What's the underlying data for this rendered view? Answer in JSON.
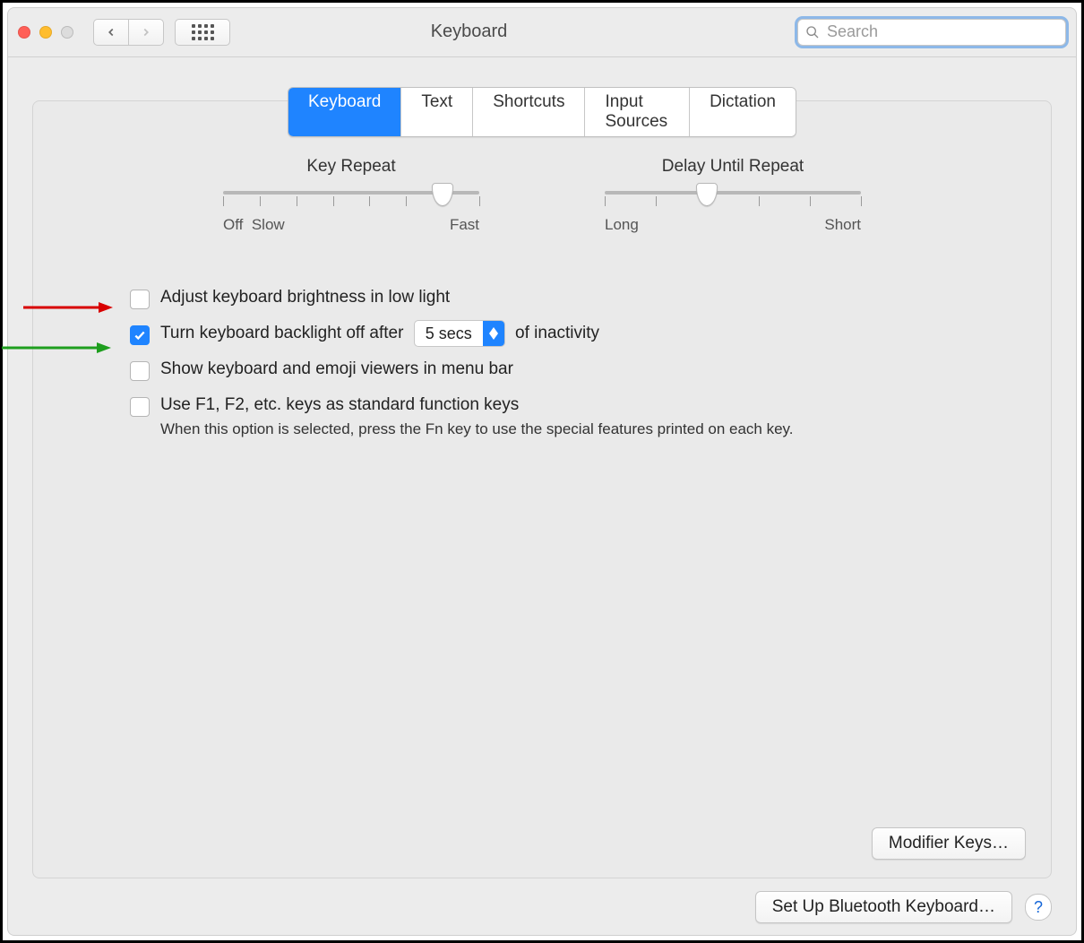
{
  "title": "Keyboard",
  "search": {
    "placeholder": "Search",
    "value": ""
  },
  "tabs": [
    {
      "label": "Keyboard",
      "active": true
    },
    {
      "label": "Text",
      "active": false
    },
    {
      "label": "Shortcuts",
      "active": false
    },
    {
      "label": "Input Sources",
      "active": false
    },
    {
      "label": "Dictation",
      "active": false
    }
  ],
  "sliders": {
    "key_repeat": {
      "label": "Key Repeat",
      "left_label": "Off",
      "left_label2": "Slow",
      "right_label": "Fast",
      "ticks": 8,
      "value_index": 6
    },
    "delay_until_repeat": {
      "label": "Delay Until Repeat",
      "left_label": "Long",
      "right_label": "Short",
      "ticks": 6,
      "value_index": 2
    }
  },
  "options": {
    "adjust_brightness": {
      "label": "Adjust keyboard brightness in low light",
      "checked": false
    },
    "backlight_off": {
      "prefix": "Turn keyboard backlight off after",
      "suffix": "of inactivity",
      "select_value": "5 secs",
      "checked": true
    },
    "show_viewers": {
      "label": "Show keyboard and emoji viewers in menu bar",
      "checked": false
    },
    "fn_keys": {
      "label": "Use F1, F2, etc. keys as standard function keys",
      "sub": "When this option is selected, press the Fn key to use the special features printed on each key.",
      "checked": false
    }
  },
  "buttons": {
    "modifier_keys": "Modifier Keys…",
    "bluetooth_keyboard": "Set Up Bluetooth Keyboard…"
  },
  "annotations": {
    "red_arrow_points_to": "adjust_brightness_checkbox",
    "green_arrow_points_to": "backlight_off_checkbox"
  }
}
